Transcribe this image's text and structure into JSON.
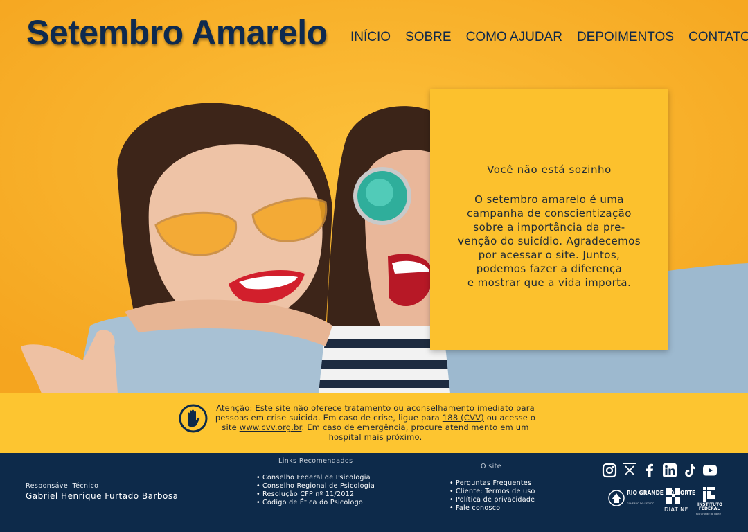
{
  "header": {
    "site_title": "Setembro Amarelo",
    "nav": [
      "INÍCIO",
      "SOBRE",
      "COMO AJUDAR",
      "DEPOIMENTOS",
      "CONTATO"
    ]
  },
  "hero": {
    "card_title": "Você não está sozinho",
    "card_text": "O setembro amarelo é uma\ncampanha de conscientização\nsobre a importância da pre-\nvenção do suicídio. Agradecemos\npor acessar o site. Juntos,\npodemos fazer a diferença\ne mostrar que a vida importa."
  },
  "notice": {
    "text_prefix": "Atenção: Este site não oferece tratamento ou aconselhamento imediato para pessoas em crise suicida. Em caso de crise, ligue para ",
    "phone_link": "188 (CVV)",
    "text_middle": " ou acesse o site ",
    "site_link": "www.cvv.org.br",
    "text_suffix": ". Em caso de emergência, procure atendimento em um hospital mais próximo."
  },
  "footer": {
    "responsavel_label": "Responsável Técnico",
    "responsavel_name": "Gabriel Henrique Furtado Barbosa",
    "links_title": "Links Recomendados",
    "links": [
      "Conselho Federal de Psicologia",
      "Conselho Regional de Psicologia",
      "Resolução CFP nº 11/2012",
      "Código de Ética do Psicólogo"
    ],
    "site_title": "O site",
    "site_links": [
      "Perguntas Frequentes",
      "Cliente: Termos de uso",
      "Política de privacidade",
      "Fale conosco"
    ],
    "socials": [
      "instagram-icon",
      "x-icon",
      "facebook-icon",
      "linkedin-icon",
      "tiktok-icon",
      "youtube-icon"
    ],
    "logos": {
      "rn_title": "RIO GRANDE DO NORTE",
      "rn_sub": "GOVERNO DO ESTADO",
      "diatinf": "DIATINF",
      "if_title": "INSTITUTO FEDERAL",
      "if_sub": "Rio Grande do Norte"
    }
  },
  "colors": {
    "brand_yellow": "#fbb62a",
    "card_yellow": "#fcc12d",
    "navy": "#0d2a4a"
  }
}
